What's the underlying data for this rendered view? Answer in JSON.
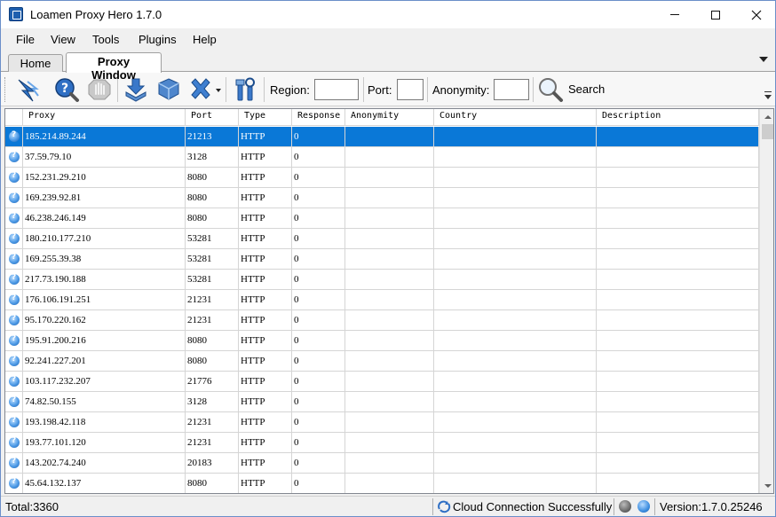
{
  "window": {
    "title": "Loamen Proxy Hero 1.7.0",
    "accent_color": "#0a78d7"
  },
  "menu": {
    "items": [
      "File",
      "View",
      "Tools",
      "Plugins",
      "Help"
    ]
  },
  "tabs": [
    {
      "label": "Home",
      "active": false
    },
    {
      "label": "Proxy Window",
      "active": true
    }
  ],
  "toolbar": {
    "buttons": [
      "lightning-run-icon",
      "help-search-icon",
      "stop-hand-icon",
      "download-arrow-icon",
      "cubes-icon",
      "delete-x-icon",
      "tools-icon"
    ],
    "region_label": "Region:",
    "region_value": "",
    "port_label": "Port:",
    "port_value": "",
    "anonymity_label": "Anonymity:",
    "anonymity_value": "",
    "search_label": "Search"
  },
  "grid": {
    "columns": [
      "Proxy",
      "Port",
      "Type",
      "Response",
      "Anonymity",
      "Country",
      "Description"
    ],
    "selected_row": 0,
    "rows": [
      {
        "proxy": "185.214.89.244",
        "port": "21213",
        "type": "HTTP",
        "response": "0",
        "anonymity": "",
        "country": "",
        "description": ""
      },
      {
        "proxy": "37.59.79.10",
        "port": "3128",
        "type": "HTTP",
        "response": "0",
        "anonymity": "",
        "country": "",
        "description": ""
      },
      {
        "proxy": "152.231.29.210",
        "port": "8080",
        "type": "HTTP",
        "response": "0",
        "anonymity": "",
        "country": "",
        "description": ""
      },
      {
        "proxy": "169.239.92.81",
        "port": "8080",
        "type": "HTTP",
        "response": "0",
        "anonymity": "",
        "country": "",
        "description": ""
      },
      {
        "proxy": "46.238.246.149",
        "port": "8080",
        "type": "HTTP",
        "response": "0",
        "anonymity": "",
        "country": "",
        "description": ""
      },
      {
        "proxy": "180.210.177.210",
        "port": "53281",
        "type": "HTTP",
        "response": "0",
        "anonymity": "",
        "country": "",
        "description": ""
      },
      {
        "proxy": "169.255.39.38",
        "port": "53281",
        "type": "HTTP",
        "response": "0",
        "anonymity": "",
        "country": "",
        "description": ""
      },
      {
        "proxy": "217.73.190.188",
        "port": "53281",
        "type": "HTTP",
        "response": "0",
        "anonymity": "",
        "country": "",
        "description": ""
      },
      {
        "proxy": "176.106.191.251",
        "port": "21231",
        "type": "HTTP",
        "response": "0",
        "anonymity": "",
        "country": "",
        "description": ""
      },
      {
        "proxy": "95.170.220.162",
        "port": "21231",
        "type": "HTTP",
        "response": "0",
        "anonymity": "",
        "country": "",
        "description": ""
      },
      {
        "proxy": "195.91.200.216",
        "port": "8080",
        "type": "HTTP",
        "response": "0",
        "anonymity": "",
        "country": "",
        "description": ""
      },
      {
        "proxy": "92.241.227.201",
        "port": "8080",
        "type": "HTTP",
        "response": "0",
        "anonymity": "",
        "country": "",
        "description": ""
      },
      {
        "proxy": "103.117.232.207",
        "port": "21776",
        "type": "HTTP",
        "response": "0",
        "anonymity": "",
        "country": "",
        "description": ""
      },
      {
        "proxy": "74.82.50.155",
        "port": "3128",
        "type": "HTTP",
        "response": "0",
        "anonymity": "",
        "country": "",
        "description": ""
      },
      {
        "proxy": "193.198.42.118",
        "port": "21231",
        "type": "HTTP",
        "response": "0",
        "anonymity": "",
        "country": "",
        "description": ""
      },
      {
        "proxy": "193.77.101.120",
        "port": "21231",
        "type": "HTTP",
        "response": "0",
        "anonymity": "",
        "country": "",
        "description": ""
      },
      {
        "proxy": "143.202.74.240",
        "port": "20183",
        "type": "HTTP",
        "response": "0",
        "anonymity": "",
        "country": "",
        "description": ""
      },
      {
        "proxy": "45.64.132.137",
        "port": "8080",
        "type": "HTTP",
        "response": "0",
        "anonymity": "",
        "country": "",
        "description": ""
      }
    ]
  },
  "status": {
    "total": "Total:3360",
    "cloud": "Cloud Connection Successfully",
    "version": "Version:1.7.0.25246"
  }
}
